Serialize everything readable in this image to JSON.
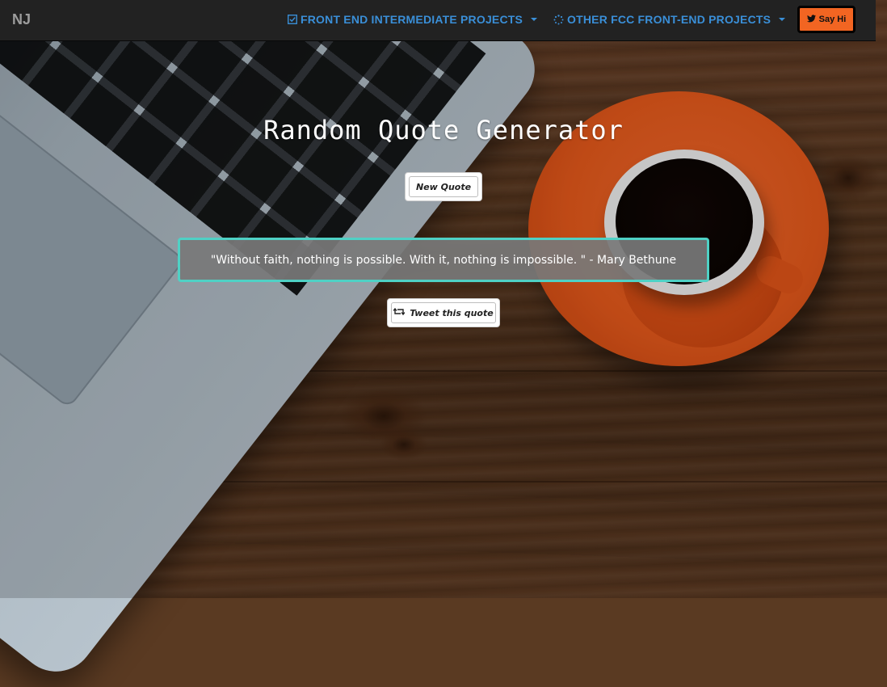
{
  "navbar": {
    "brand": "NJ",
    "menu1": {
      "label": "FRONT END INTERMEDIATE PROJECTS",
      "icon": "checkbox-icon"
    },
    "menu2": {
      "label": "OTHER FCC FRONT-END PROJECTS",
      "icon": "spinner-icon"
    },
    "say_hi": {
      "label": "Say Hi",
      "icon": "twitter-icon"
    }
  },
  "main": {
    "title": "Random Quote Generator",
    "new_quote_label": "New Quote",
    "quote": "\"Without faith, nothing is possible. With it, nothing is impossible. \" - Mary Bethune",
    "tweet_label": "Tweet this quote",
    "tweet_icon": "retweet-icon"
  },
  "colors": {
    "navbar_bg": "#222222",
    "nav_link": "#3a8fd8",
    "say_hi_bg": "#f26522",
    "quote_border": "#4fd1c5",
    "quote_bg": "#787878"
  }
}
